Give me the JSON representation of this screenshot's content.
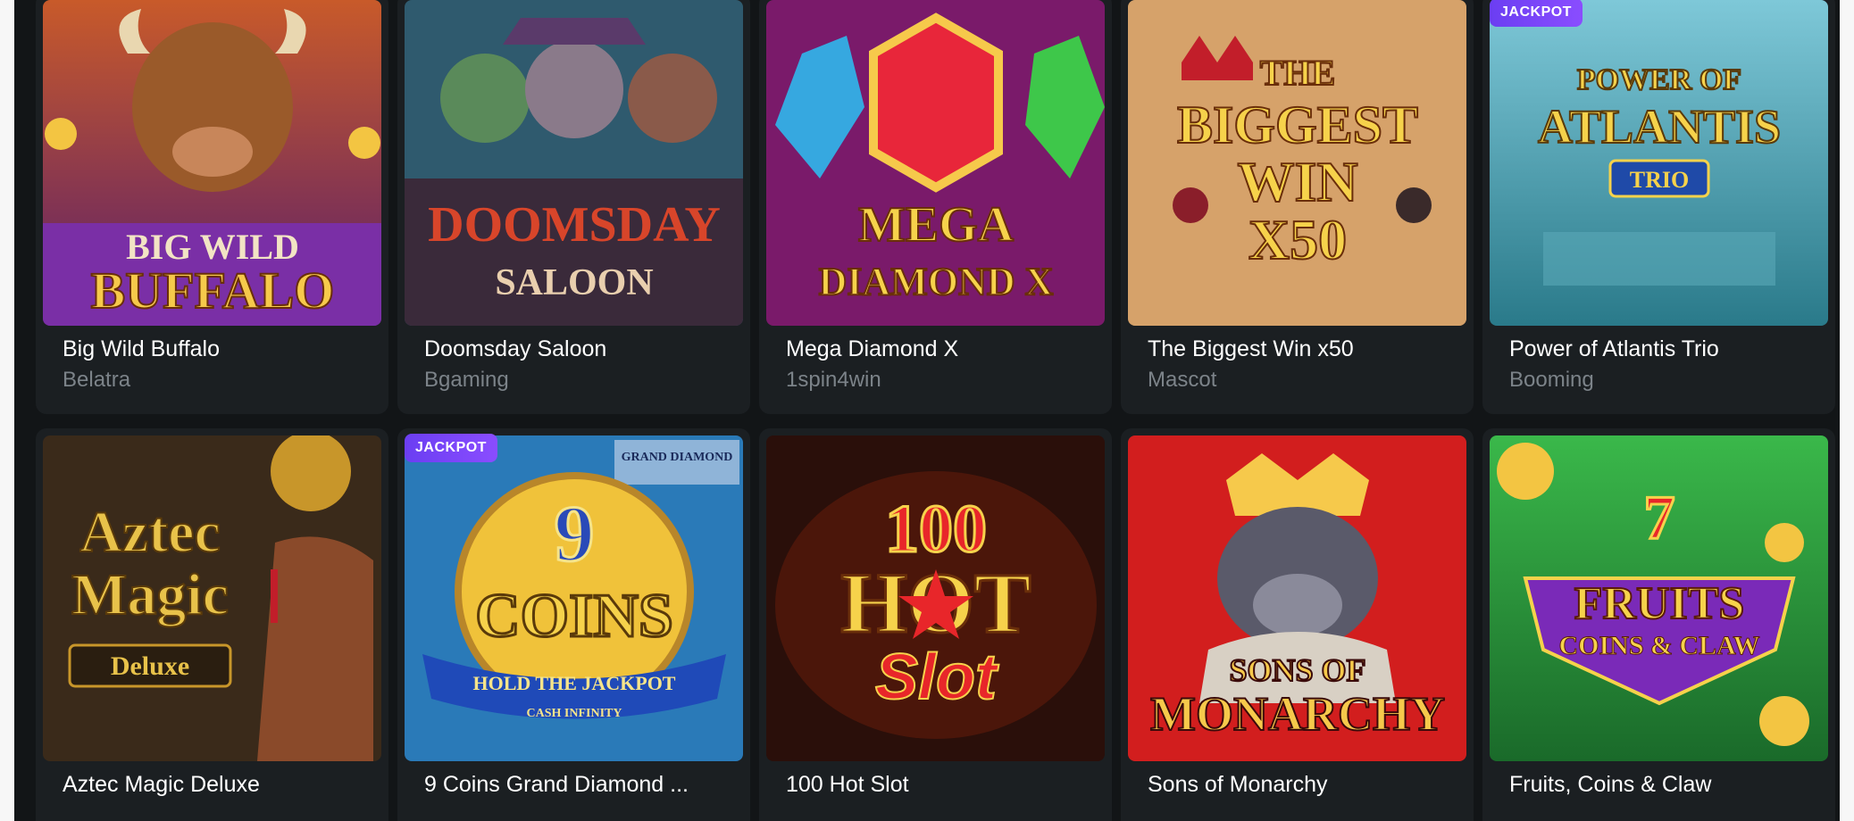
{
  "games": [
    {
      "name": "Big Wild Buffalo",
      "provider": "Belatra",
      "logo_lines": [
        "BIG WILD",
        "BUFFALO"
      ],
      "badge": ""
    },
    {
      "name": "Doomsday Saloon",
      "provider": "Bgaming",
      "logo_lines": [
        "DOOMSDAY",
        "SALOON"
      ],
      "badge": ""
    },
    {
      "name": "Mega Diamond X",
      "provider": "1spin4win",
      "logo_lines": [
        "MEGA",
        "DIAMOND X"
      ],
      "badge": ""
    },
    {
      "name": "The Biggest Win x50",
      "provider": "Mascot",
      "logo_lines": [
        "THE",
        "BIGGEST",
        "WIN",
        "X50"
      ],
      "badge": ""
    },
    {
      "name": "Power of Atlantis Trio",
      "provider": "Booming",
      "logo_lines": [
        "POWER OF",
        "ATLANTIS",
        "TRIO"
      ],
      "badge": "JACKPOT"
    },
    {
      "name": "Aztec Magic Deluxe",
      "provider": "",
      "logo_lines": [
        "Aztec",
        "Magic",
        "Deluxe"
      ],
      "badge": ""
    },
    {
      "name": "9 Coins Grand Diamond ...",
      "provider": "",
      "logo_lines": [
        "9",
        "COINS",
        "HOLD THE JACKPOT",
        "CASH INFINITY",
        "GRAND DIAMOND"
      ],
      "badge": "JACKPOT"
    },
    {
      "name": "100 Hot Slot",
      "provider": "",
      "logo_lines": [
        "100",
        "HOT",
        "Slot"
      ],
      "badge": ""
    },
    {
      "name": "Sons of Monarchy",
      "provider": "",
      "logo_lines": [
        "SONS OF",
        "MONARCHY"
      ],
      "badge": ""
    },
    {
      "name": "Fruits, Coins & Claw",
      "provider": "",
      "logo_lines": [
        "7",
        "FRUITS",
        "COINS & CLAW"
      ],
      "badge": ""
    }
  ],
  "colors": {
    "background": "#121517",
    "card": "#1b1f22",
    "title": "#ffffff",
    "provider": "#7c8389",
    "jackpot_badge": "#7b46f7"
  },
  "icons": [
    "buffalo-art",
    "cowboys-art",
    "gem-art",
    "crown-art",
    "atlantis-art",
    "aztec-art",
    "coin-art",
    "star-art",
    "gorilla-art",
    "fruit-art"
  ]
}
